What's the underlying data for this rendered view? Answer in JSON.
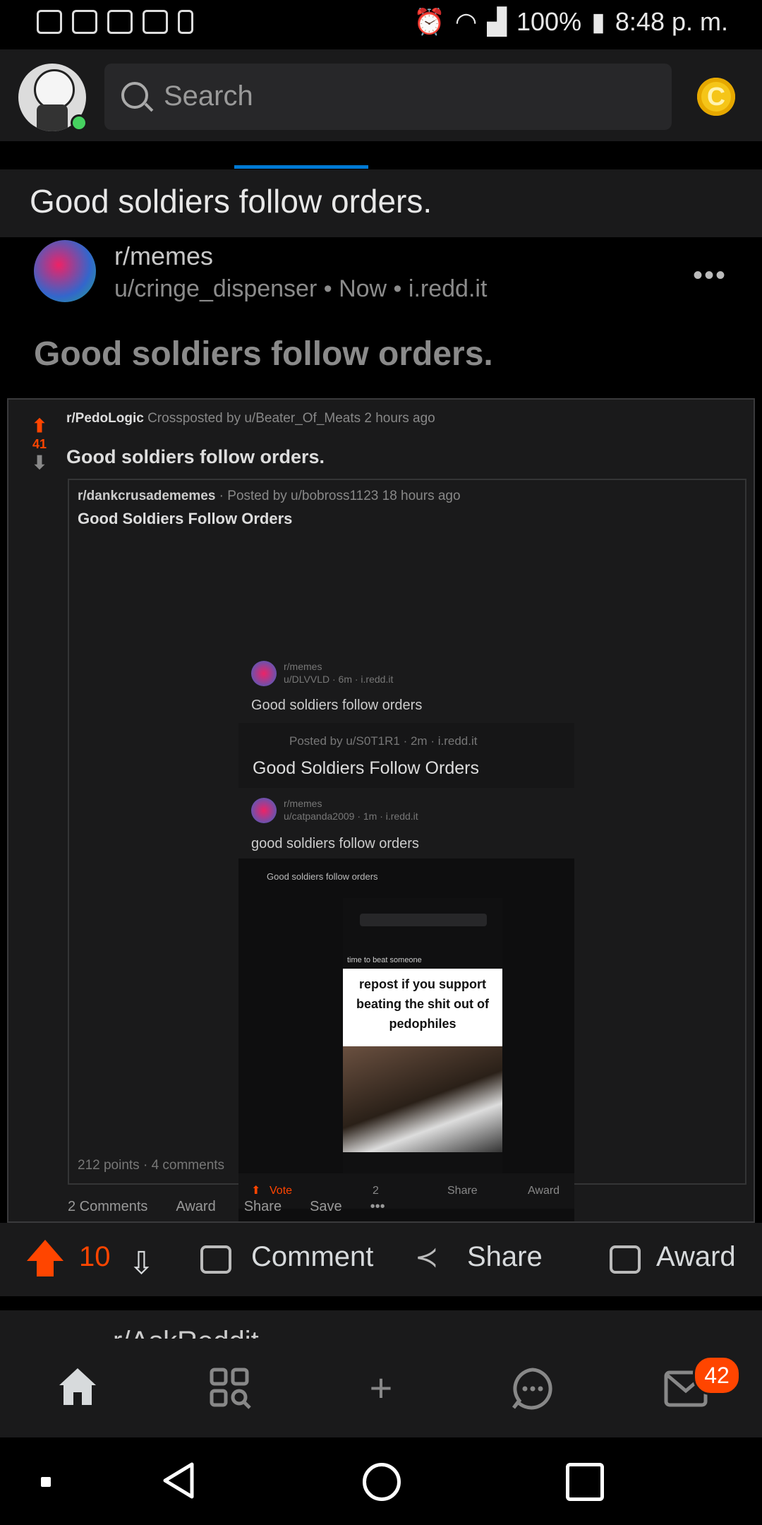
{
  "status": {
    "battery": "100%",
    "time": "8:48 p. m."
  },
  "top": {
    "search_placeholder": "Search"
  },
  "page": {
    "title": "Good soldiers follow orders."
  },
  "post": {
    "subreddit": "r/memes",
    "author": "u/cringe_dispenser",
    "age": "Now",
    "domain": "i.redd.it",
    "meta_line": "u/cringe_dispenser • Now • i.redd.it",
    "title": "Good soldiers follow orders.",
    "score": "10"
  },
  "screenshot": {
    "votes": "41",
    "xpost_sub": "r/PedoLogic",
    "xpost_info": "Crossposted by u/Beater_Of_Meats 2 hours ago",
    "xpost_title": "Good soldiers follow orders.",
    "inner_sub": "r/dankcrusadememes",
    "inner_info": "· Posted by u/bobross1123 18 hours ago",
    "inner_title": "Good Soldiers Follow Orders",
    "l1_sub": "r/memes",
    "l1_user": "u/DLVVLD · 6m · i.redd.it",
    "l1_title": "Good soldiers follow orders",
    "l2_info": "Posted by u/S0T1R1 · 2m · i.redd.it",
    "l2_title": "Good Soldiers Follow Orders",
    "l3_sub": "r/memes",
    "l3_user": "u/catpanda2009 · 1m · i.redd.it",
    "l3_title": "good soldiers follow orders",
    "l4_title": "Good soldiers follow orders",
    "l5_title": "time to beat someone",
    "meme_text": "repost if you support beating the shit out of pedophiles",
    "bar_vote": "Vote",
    "bar_comments": "2",
    "bar_share": "Share",
    "bar_award": "Award",
    "inner_footer": "212 points · 4 comments",
    "act_comments": "2 Comments",
    "act_award": "Award",
    "act_share": "Share",
    "act_save": "Save"
  },
  "actions": {
    "comment": "Comment",
    "share": "Share",
    "award": "Award"
  },
  "next_post": {
    "partial": "r/AskReddit"
  },
  "nav": {
    "inbox_badge": "42"
  },
  "colors": {
    "accent": "#ff4500",
    "tab": "#0079d3",
    "surface": "#1a1a1b",
    "coin": "#f5c518"
  }
}
